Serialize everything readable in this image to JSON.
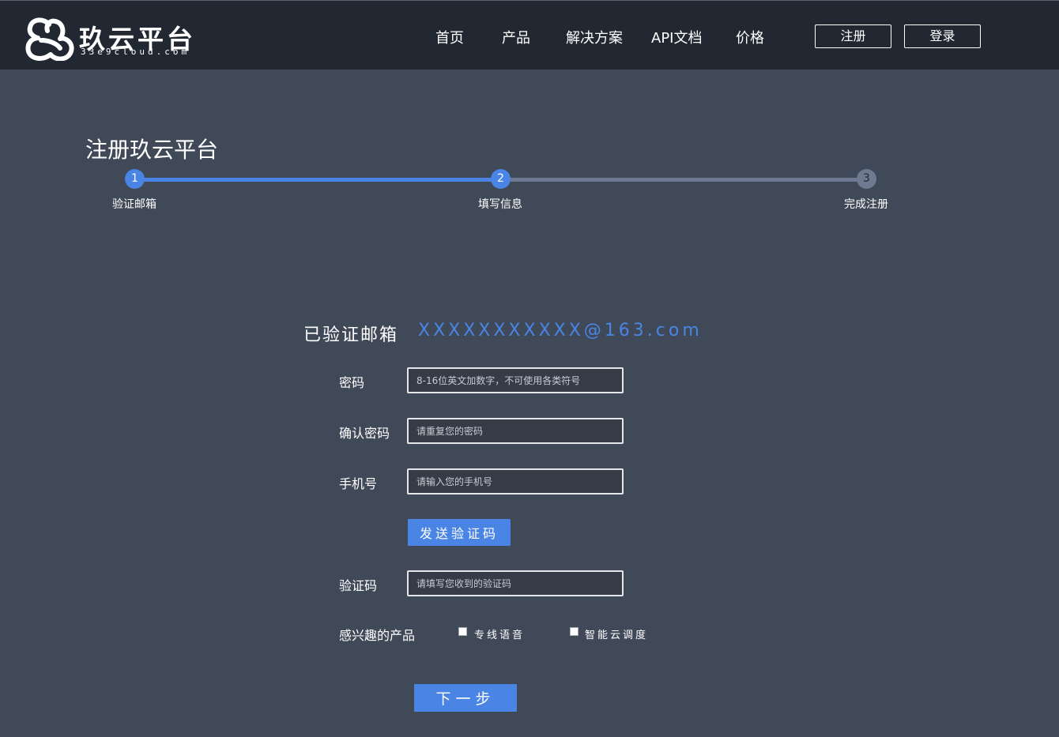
{
  "header": {
    "logo_name": "玖云平台",
    "logo_domain": "33e9cloud.com",
    "nav": [
      "首页",
      "产品",
      "解决方案",
      "API文档",
      "价格"
    ],
    "register_label": "注册",
    "login_label": "登录"
  },
  "page_title": "注册玖云平台",
  "steps": [
    {
      "number": "1",
      "label": "验证邮箱",
      "status": "done"
    },
    {
      "number": "2",
      "label": "填写信息",
      "status": "current"
    },
    {
      "number": "3",
      "label": "完成注册",
      "status": "pending"
    }
  ],
  "form": {
    "verified_label": "已验证邮箱",
    "verified_email": "XXXXXXXXXXX@163.com",
    "password": {
      "label": "密码",
      "placeholder": "8-16位英文加数字，不可使用各类符号",
      "value": ""
    },
    "confirm_password": {
      "label": "确认密码",
      "placeholder": "请重复您的密码",
      "value": ""
    },
    "phone": {
      "label": "手机号",
      "placeholder": "请输入您的手机号",
      "value": ""
    },
    "send_code_label": "发送验证码",
    "code": {
      "label": "验证码",
      "placeholder": "请填写您收到的验证码",
      "value": ""
    },
    "interests_label": "感兴趣的产品",
    "interests": [
      {
        "label": "专线语音",
        "checked": false
      },
      {
        "label": "智能云调度",
        "checked": false
      }
    ],
    "next_label": "下一步"
  },
  "colors": {
    "header_bg": "#222831",
    "page_bg": "#404958",
    "accent": "#4a85e5",
    "pending_track": "#6e7a92"
  }
}
